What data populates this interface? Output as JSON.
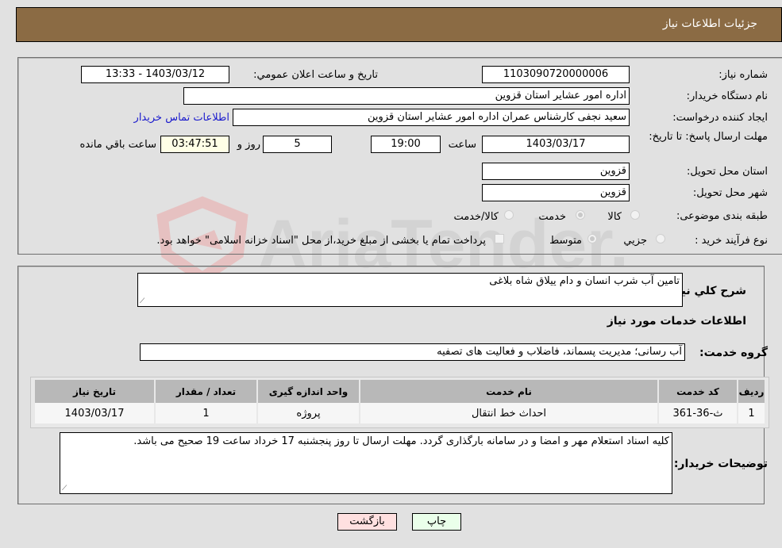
{
  "header": {
    "title": "جزئیات اطلاعات نیاز"
  },
  "details": {
    "need_number": {
      "label": "شماره نیاز:",
      "value": "1103090720000006"
    },
    "announce_datetime": {
      "label": "تاریخ و ساعت اعلان عمومي:",
      "value": "1403/03/12 - 13:33"
    },
    "buyer_org": {
      "label": "نام دستگاه خریدار:",
      "value": "اداره امور عشایر استان قزوین"
    },
    "requester": {
      "label": "ایجاد کننده درخواست:",
      "value": "سعید نجفی کارشناس عمران اداره امور عشایر استان قزوین",
      "contact_link": "اطلاعات تماس خریدار"
    },
    "deadline": {
      "label": "مهلت ارسال پاسخ: تا تاریخ:",
      "date": "1403/03/17",
      "time_label": "ساعت",
      "time": "19:00",
      "days": "5",
      "days_label": "روز و",
      "remaining": "03:47:51",
      "remaining_label": "ساعت باقي مانده"
    },
    "province": {
      "label": "استان محل تحویل:",
      "value": "قزوین"
    },
    "city": {
      "label": "شهر محل تحویل:",
      "value": "قزوین"
    },
    "category": {
      "label": "طبقه بندی موضوعی:",
      "options": [
        "کالا",
        "خدمت",
        "کالا/خدمت"
      ],
      "selected": "خدمت"
    },
    "purchase_process": {
      "label": "نوع فرآیند خرید :",
      "options": [
        "جزیي",
        "متوسط"
      ],
      "selected": "متوسط",
      "treasury_note": "پرداخت تمام یا بخشی از مبلغ خرید،از محل \"اسناد خزانه اسلامی\" خواهد بود."
    }
  },
  "description": {
    "label": "شرح کلي نیاز:",
    "value": "تامین آب شرب انسان و دام ییلاق شاه بلاغی"
  },
  "services_section_title": "اطلاعات خدمات مورد نیاز",
  "service_group": {
    "label": "گروه خدمت:",
    "value": "آب رسانی؛ مدیریت پسماند، فاضلاب و فعالیت های تصفیه"
  },
  "table": {
    "columns": [
      "ردیف",
      "کد خدمت",
      "نام خدمت",
      "واحد اندازه گیری",
      "تعداد / مقدار",
      "تاریخ نیاز"
    ],
    "rows": [
      [
        "1",
        "ث-36-361",
        "احداث خط انتقال",
        "پروژه",
        "1",
        "1403/03/17"
      ]
    ]
  },
  "buyer_notes": {
    "label": "توضیحات خریدار:",
    "value": "کلیه اسناد استعلام مهر و امضا و در سامانه بارگذاری گردد. مهلت ارسال تا روز پنجشنبه 17 خرداد ساعت 19 صحیح می باشد."
  },
  "buttons": {
    "print": "چاپ",
    "back": "بازگشت"
  },
  "watermark": {
    "text": "AriaTender.neT"
  }
}
